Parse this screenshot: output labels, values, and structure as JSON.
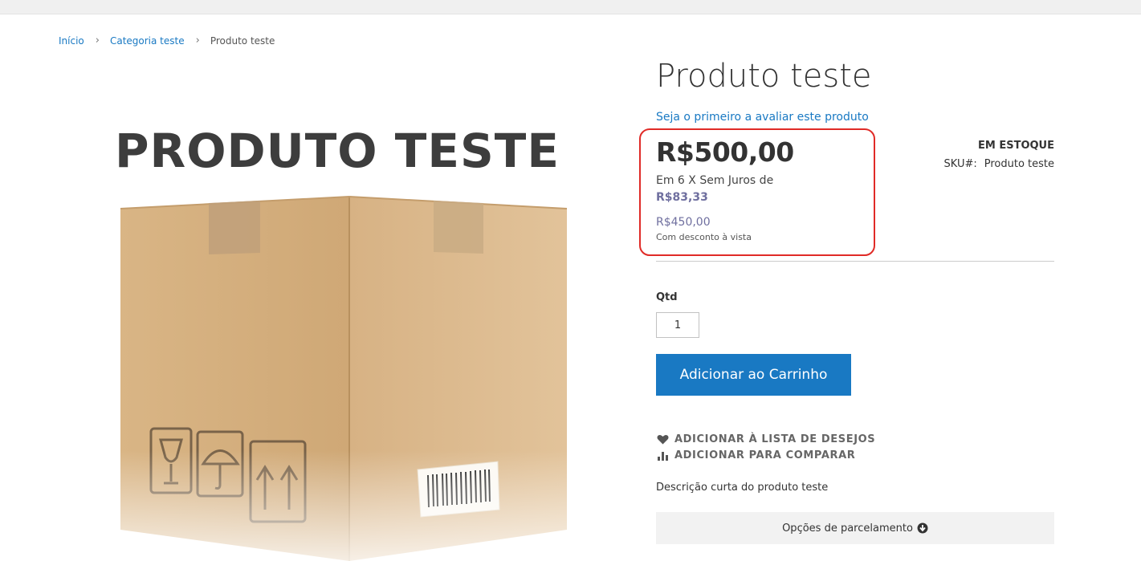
{
  "topbar": {},
  "breadcrumb": {
    "items": [
      "Início",
      "Categoria teste"
    ],
    "current": "Produto teste",
    "separator": "›"
  },
  "product": {
    "image_text": "PRODUTO TESTE",
    "title": "Produto teste",
    "review_link": "Seja o primeiro a avaliar este produto",
    "price": "R$500,00",
    "installments_text": "Em 6 X Sem Juros de",
    "installment_value": "R$83,33",
    "cash_price": "R$450,00",
    "cash_note": "Com desconto à vista",
    "stock": "EM ESTOQUE",
    "sku_label": "SKU#:",
    "sku_value": "Produto teste",
    "qty_label": "Qtd",
    "qty_value": "1",
    "add_to_cart": "Adicionar ao Carrinho",
    "wishlist": "ADICIONAR À LISTA DE DESEJOS",
    "compare": "ADICIONAR PARA COMPARAR",
    "short_description": "Descrição curta do produto teste",
    "installment_options": "Opções de parcelamento"
  },
  "icons": {
    "wishlist": "heart-icon",
    "compare": "bar-chart-icon",
    "installment_toggle": "circle-arrow-down-icon"
  },
  "colors": {
    "link": "#1979c3",
    "button": "#1979c3",
    "highlight_border": "#e02b27",
    "installment_text": "#6f6f9f"
  }
}
